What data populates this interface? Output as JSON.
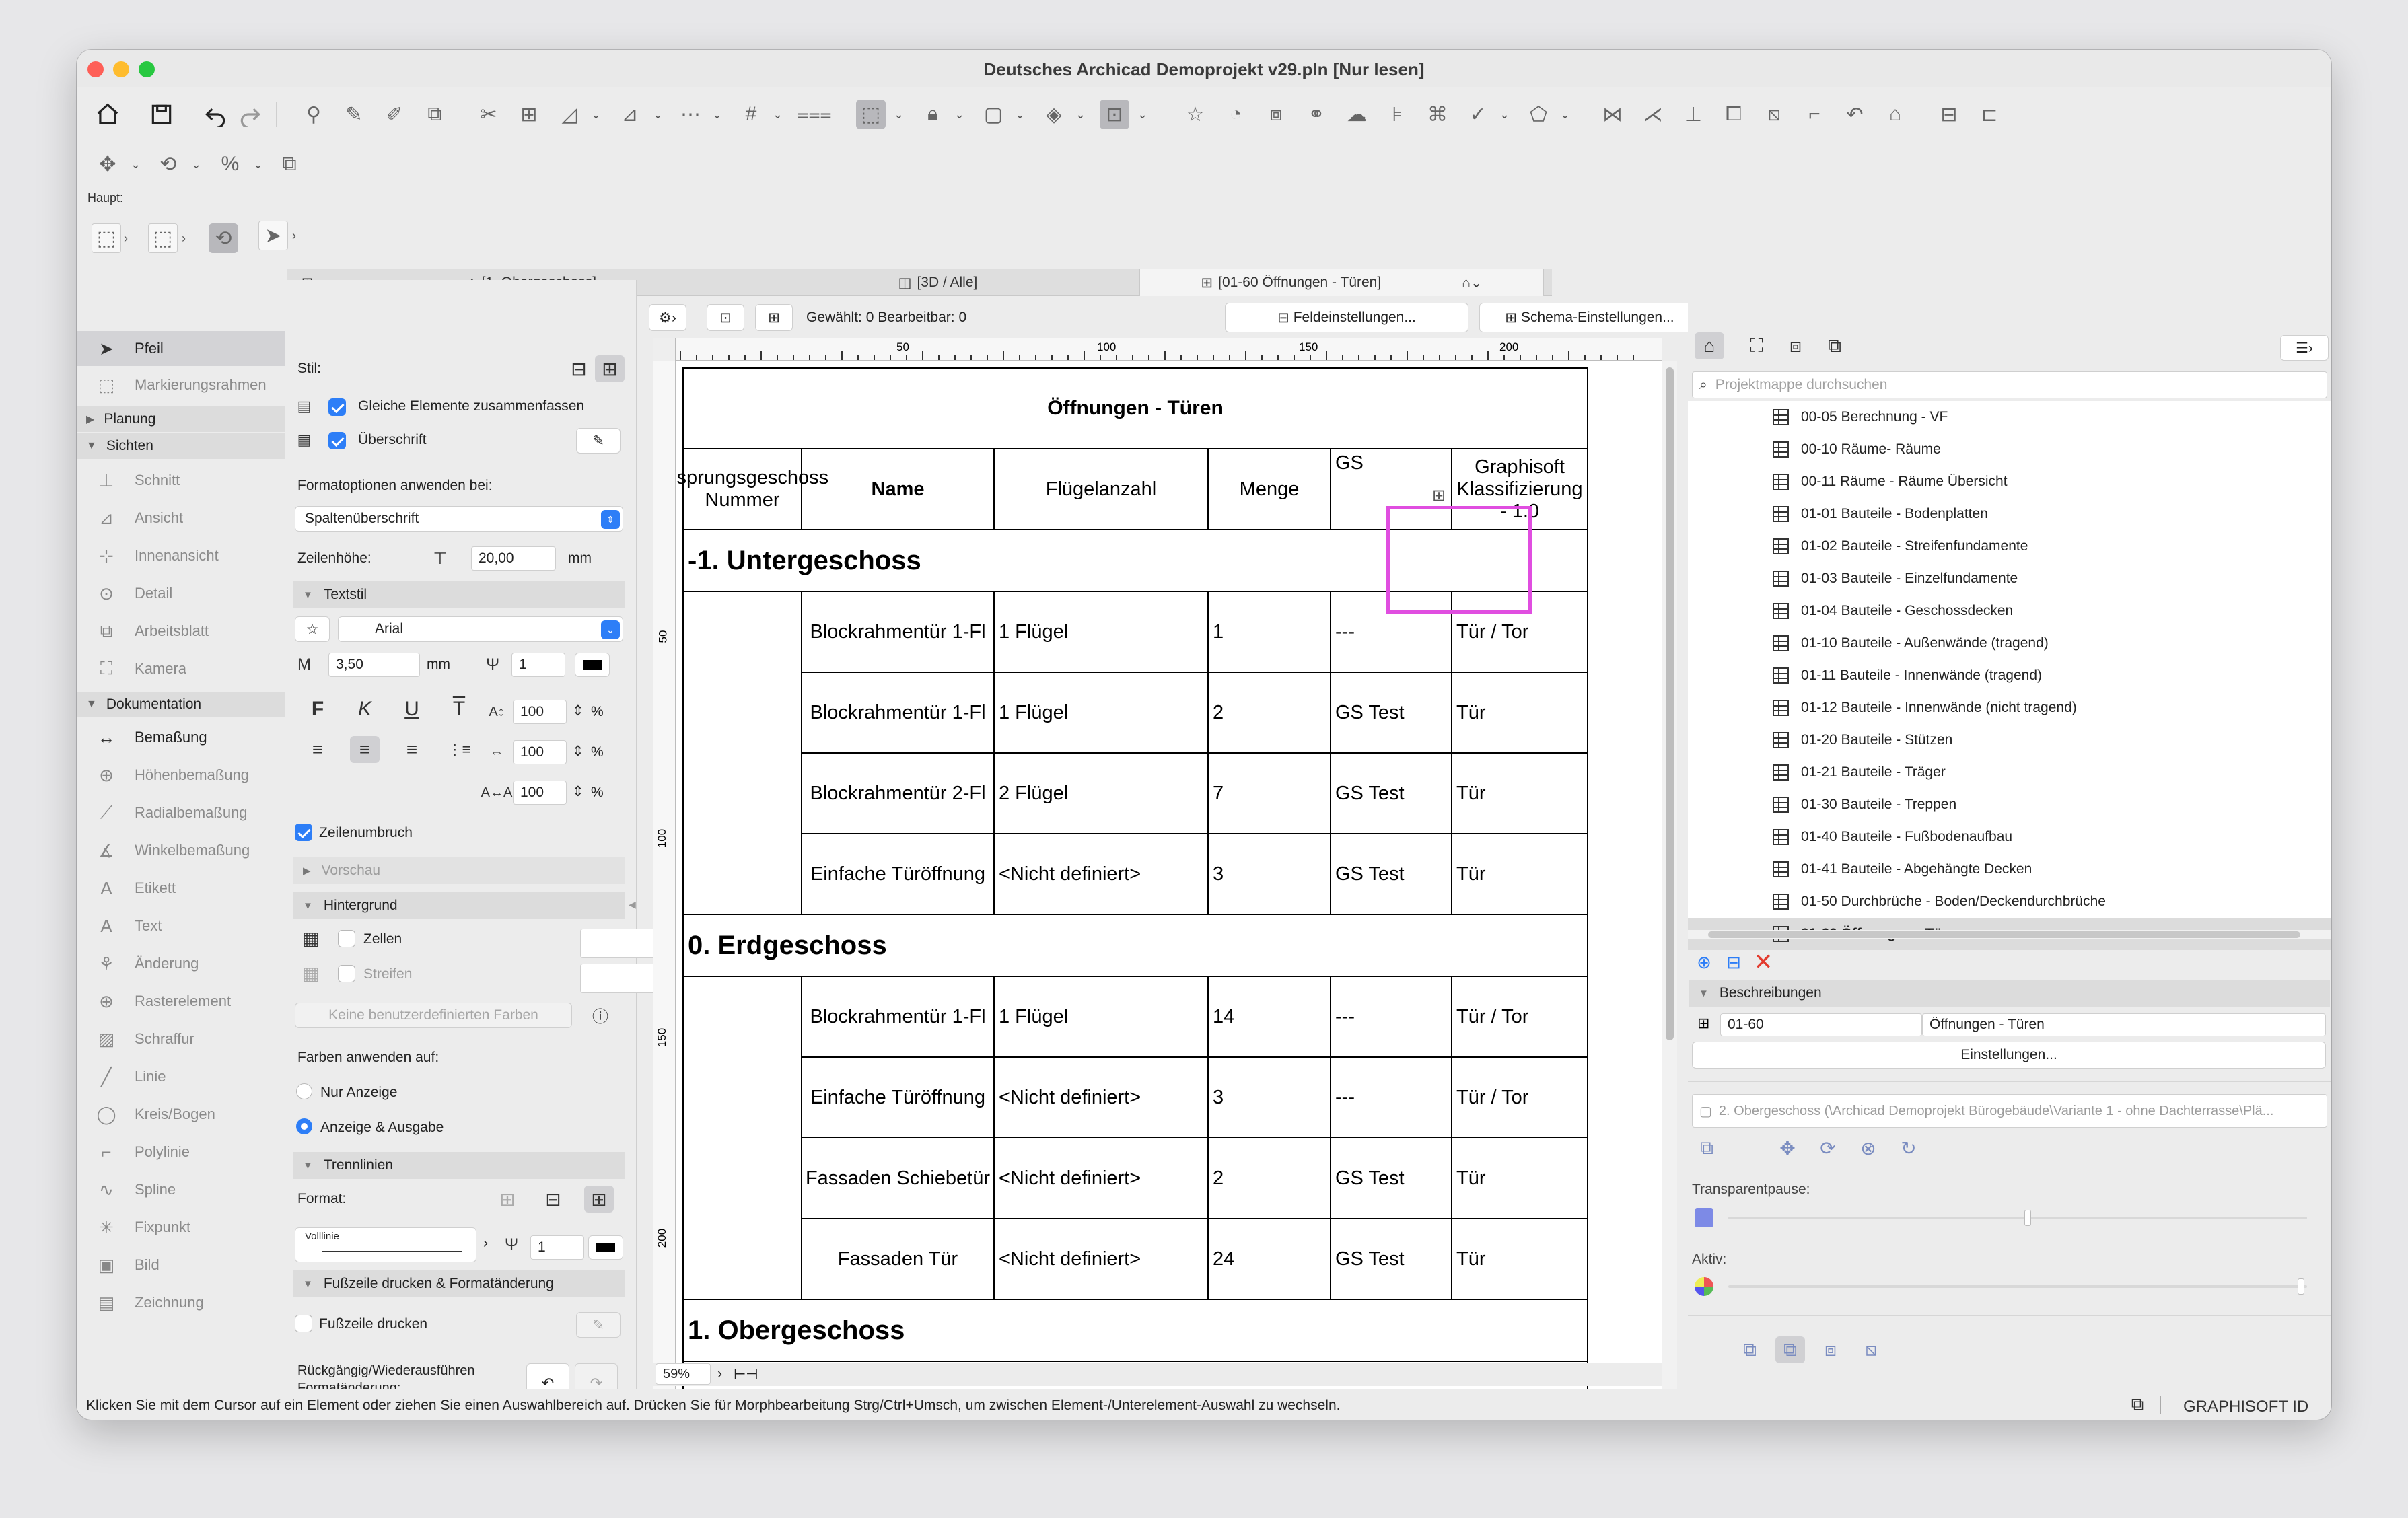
{
  "window": {
    "title": "Deutsches Archicad Demoprojekt v29.pln [Nur lesen]"
  },
  "toolbar": {
    "haupt_label": "Haupt:"
  },
  "toolbox": {
    "arrow_label": "Pfeil",
    "marquee_label": "Markierungsrahmen",
    "group_planung": "Planung",
    "group_sichten": "Sichten",
    "sichten_items": [
      "Schnitt",
      "Ansicht",
      "Innenansicht",
      "Detail",
      "Arbeitsblatt",
      "Kamera"
    ],
    "group_dokumentation": "Dokumentation",
    "doc_items": [
      "Bemaßung",
      "Höhenbemaßung",
      "Radialbemaßung",
      "Winkelbemaßung",
      "Etikett",
      "Text",
      "Änderung",
      "Rasterelement",
      "Schraffur",
      "Linie",
      "Kreis/Bogen",
      "Polylinie",
      "Spline",
      "Fixpunkt",
      "Bild",
      "Zeichnung"
    ]
  },
  "settings": {
    "stil_label": "Stil:",
    "gleiche_label": "Gleiche Elemente zusammenfassen",
    "ueberschrift_label": "Überschrift",
    "formatoptionen_label": "Formatoptionen anwenden bei:",
    "formatoptionen_value": "Spaltenüberschrift",
    "zeilenhoehe_label": "Zeilenhöhe:",
    "zeilenhoehe_value": "20,00",
    "unit_mm": "mm",
    "textstil_label": "Textstil",
    "font_value": "Arial",
    "font_size_value": "3,50",
    "pen_value": "1",
    "scale_values": [
      "100",
      "100",
      "100"
    ],
    "percent": "%",
    "bold_glyph": "F",
    "italic_glyph": "K",
    "underline_glyph": "U",
    "strike_glyph": "T",
    "zeilenumbruch_label": "Zeilenumbruch",
    "vorschau_label": "Vorschau",
    "hintergrund_label": "Hintergrund",
    "zellen_label": "Zellen",
    "streifen_label": "Streifen",
    "keine_farben_label": "Keine benutzerdefinierten Farben",
    "farben_label": "Farben anwenden auf:",
    "nur_anzeige_label": "Nur Anzeige",
    "anzeige_ausgabe_label": "Anzeige & Ausgabe",
    "trennlinien_label": "Trennlinien",
    "format_label": "Format:",
    "linetype_value": "Volllinie",
    "line_pen_value": "1",
    "fusszeile_section_label": "Fußzeile drucken & Formatänderung",
    "fusszeile_label": "Fußzeile drucken",
    "undo_label_1": "Rückgängig/Wiederausführen",
    "undo_label_2": "Formatänderung:"
  },
  "tabs": [
    {
      "label": "[1. Obergeschoss]"
    },
    {
      "label": "[3D / Alle]"
    },
    {
      "label": "[01-60 Öffnungen - Türen]"
    }
  ],
  "schedule_toolbar": {
    "selection_status": "Gewählt: 0  Bearbeitbar: 0",
    "feld_button": "Feldeinstellungen...",
    "schema_button": "Schema-Einstellungen..."
  },
  "ruler": {
    "ticks": [
      "50",
      "100",
      "150",
      "200"
    ],
    "vticks": [
      "50",
      "100",
      "150",
      "200"
    ]
  },
  "schedule": {
    "title": "Öffnungen - Türen",
    "headers": [
      "Ursprungsgeschoss Nummer",
      "Name",
      "Flügelanzahl",
      "Menge",
      "GS",
      "Graphisoft Klassifizierung - 1.0"
    ],
    "sections": [
      {
        "name": "-1. Untergeschoss",
        "rows": [
          [
            "Blockrahmentür 1-Fl",
            "1 Flügel",
            "1",
            "---",
            "Tür / Tor"
          ],
          [
            "Blockrahmentür 1-Fl",
            "1 Flügel",
            "2",
            "GS Test",
            "Tür"
          ],
          [
            "Blockrahmentür 2-Fl",
            "2 Flügel",
            "7",
            "GS Test",
            "Tür"
          ],
          [
            "Einfache Türöffnung",
            "<Nicht definiert>",
            "3",
            "GS Test",
            "Tür"
          ]
        ]
      },
      {
        "name": "0. Erdgeschoss",
        "rows": [
          [
            "Blockrahmentür 1-Fl",
            "1 Flügel",
            "14",
            "---",
            "Tür / Tor"
          ],
          [
            "Einfache Türöffnung",
            "<Nicht definiert>",
            "3",
            "---",
            "Tür / Tor"
          ],
          [
            "Fassaden Schiebetür",
            "<Nicht definiert>",
            "2",
            "GS Test",
            "Tür"
          ],
          [
            "Fassaden Tür",
            "<Nicht definiert>",
            "24",
            "GS Test",
            "Tür"
          ]
        ]
      },
      {
        "name": "1. Obergeschoss",
        "rows": []
      }
    ]
  },
  "zoom": {
    "value": "59%"
  },
  "navigator": {
    "search_placeholder": "Projektmappe durchsuchen",
    "items": [
      "00-05 Berechnung - VF",
      "00-10 Räume- Räume",
      "00-11 Räume - Räume Übersicht",
      "01-01 Bauteile - Bodenplatten",
      "01-02 Bauteile - Streifenfundamente",
      "01-03 Bauteile - Einzelfundamente",
      "01-04 Bauteile - Geschossdecken",
      "01-10 Bauteile - Außenwände (tragend)",
      "01-11 Bauteile - Innenwände (tragend)",
      "01-12 Bauteile - Innenwände (nicht tragend)",
      "01-20 Bauteile - Stützen",
      "01-21 Bauteile - Träger",
      "01-30 Bauteile - Treppen",
      "01-40 Bauteile - Fußbodenaufbau",
      "01-41 Bauteile - Abgehängte Decken",
      "01-50 Durchbrüche - Boden/Deckendurchbrüche",
      "01-60 Öffnungen - Türen"
    ],
    "beschreibungen_label": "Beschreibungen",
    "id_value": "01-60",
    "name_value": "Öffnungen - Türen",
    "einstellungen_button": "Einstellungen...",
    "preview_path": "2. Obergeschoss (\\Archicad Demoprojekt Bürogebäude\\Variante 1 - ohne Dachterrasse\\Plä...",
    "transparentpause_label": "Transparentpause:",
    "aktiv_label": "Aktiv:"
  },
  "status": {
    "message": "Klicken Sie mit dem Cursor auf ein Element oder ziehen Sie einen Auswahlbereich auf. Drücken Sie für Morphbearbeitung Strg/Ctrl+Umsch, um zwischen Element-/Unterelement-Auswahl zu wechseln.",
    "brand": "GRAPHISOFT ID"
  },
  "colors": {
    "accent": "#2d7ef7",
    "highlight": "#e04ee0",
    "close": "#fe5f57",
    "minimize": "#febc2e",
    "zoom": "#28c840",
    "delete": "#e33b2e"
  }
}
